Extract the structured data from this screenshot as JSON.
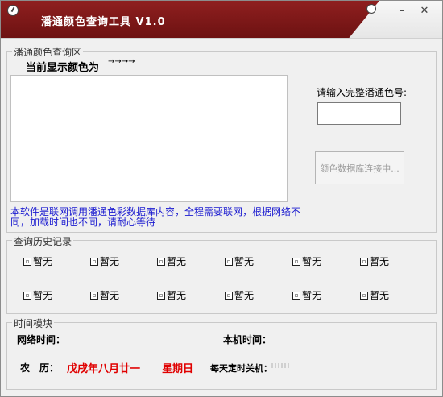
{
  "title": "潘通颜色查询工具   V1.0",
  "window_controls": {
    "minimize": "–",
    "close": "✕"
  },
  "query_group": {
    "legend": "潘通颜色查询区",
    "current_color_label": "当前显示颜色为",
    "arrows": "→→→→",
    "prompt": "请输入完整潘通色号:",
    "input_value": "",
    "db_button": "颜色数据库连接中...",
    "notice": "本软件是联网调用潘通色彩数据库内容，全程需要联网，根据网络不同，加载时间也不同，请耐心等待"
  },
  "history_group": {
    "legend": "查询历史记录",
    "items": [
      "暂无",
      "暂无",
      "暂无",
      "暂无",
      "暂无",
      "暂无",
      "暂无",
      "暂无",
      "暂无",
      "暂无",
      "暂无",
      "暂无"
    ]
  },
  "time_group": {
    "legend": "时间模块",
    "network_time_label": "网络时间：",
    "local_time_label": "本机时间：",
    "lunar_label": "农　历：",
    "lunar_value": "戊戌年八月廿一",
    "weekday": "星期日",
    "shutdown_label": "每天定时关机："
  },
  "colors": {
    "title_bar": "#7a1818",
    "notice": "#1a1ad0",
    "lunar": "#e00000"
  }
}
